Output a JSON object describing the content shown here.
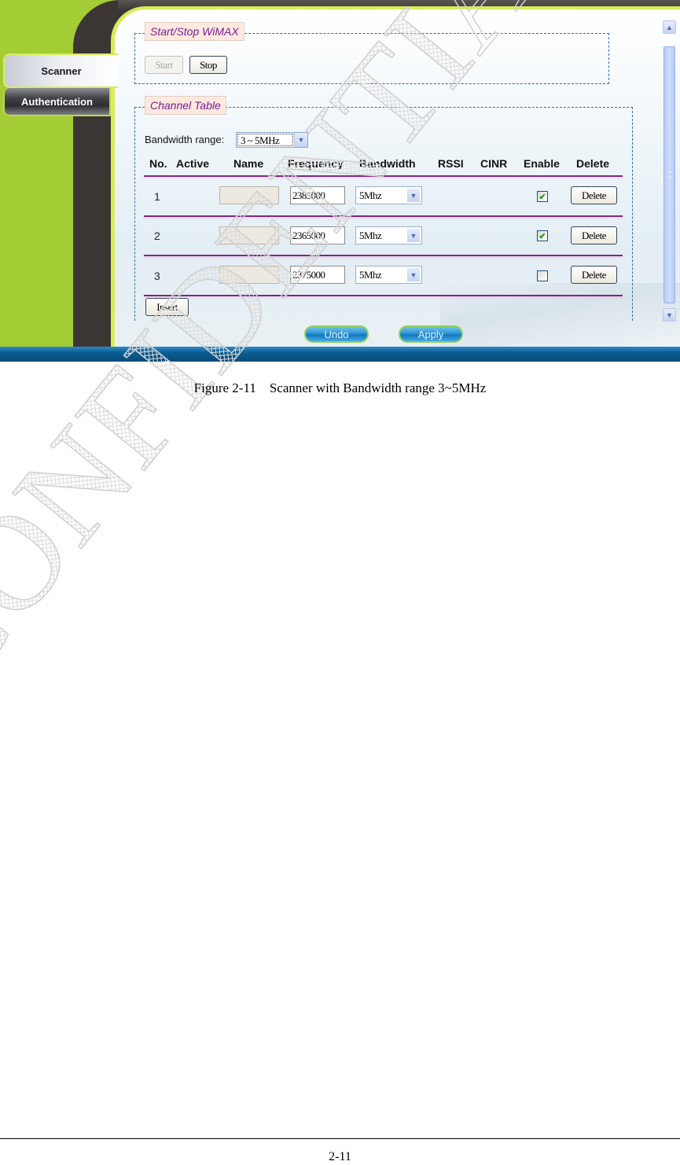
{
  "screenshot": {
    "sidebar": {
      "tabs": [
        {
          "label": "Scanner",
          "active": true
        },
        {
          "label": "Authentication",
          "active": false
        }
      ]
    },
    "start_stop": {
      "legend": "Start/Stop WiMAX",
      "start_label": "Start",
      "start_disabled": true,
      "stop_label": "Stop"
    },
    "channel_table": {
      "legend": "Channel Table",
      "bandwidth_range_label": "Bandwidth range:",
      "bandwidth_range_value": "3 ~ 5MHz",
      "columns": [
        "No.",
        "Active",
        "Name",
        "Frequency",
        "Bandwidth",
        "RSSI",
        "CINR",
        "Enable",
        "Delete"
      ],
      "rows": [
        {
          "no": "1",
          "active": "",
          "name": "",
          "frequency": "2385000",
          "bandwidth": "5Mhz",
          "rssi": "",
          "cinr": "",
          "enabled": true,
          "delete_label": "Delete"
        },
        {
          "no": "2",
          "active": "",
          "name": "",
          "frequency": "2365000",
          "bandwidth": "5Mhz",
          "rssi": "",
          "cinr": "",
          "enabled": true,
          "delete_label": "Delete"
        },
        {
          "no": "3",
          "active": "",
          "name": "",
          "frequency": "2375000",
          "bandwidth": "5Mhz",
          "rssi": "",
          "cinr": "",
          "enabled": false,
          "delete_label": "Delete"
        }
      ],
      "insert_label": "Insert"
    },
    "actions": {
      "undo_label": "Undo",
      "apply_label": "Apply"
    },
    "icons": {
      "dropdown_arrow": "chevron-down-icon",
      "check": "checkmark-icon",
      "scroll_up": "chevron-up-icon",
      "scroll_down": "chevron-down-icon"
    },
    "colors": {
      "brand_green": "#a3cc35",
      "frame_dark": "#3b3634",
      "legend_text": "#7a1f8f",
      "row_rule": "#7e2a7a",
      "bottom_bar": "#0b5e93"
    }
  },
  "document": {
    "caption": "Figure 2-11    Scanner with Bandwidth range 3~5MHz",
    "watermark": "CONFIDENTIAL",
    "page_number": "2-11"
  }
}
